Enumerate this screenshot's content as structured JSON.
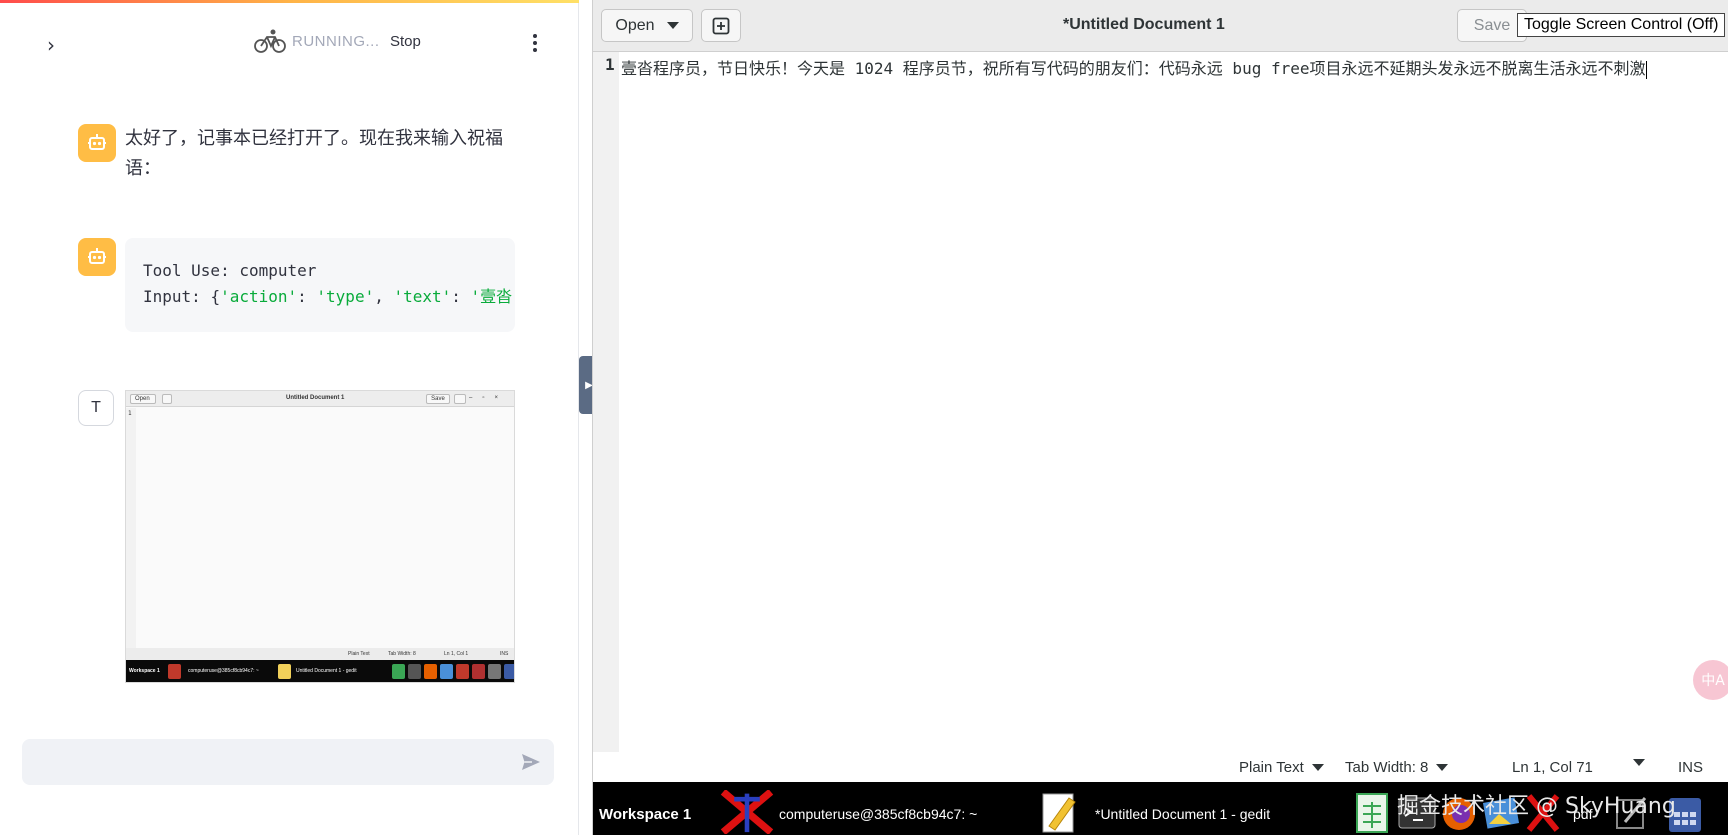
{
  "chat": {
    "status_label": "RUNNING...",
    "stop_label": "Stop",
    "assistant_message": "太好了，记事本已经打开了。现在我来输入祝福语：",
    "tool_line1_key": "Tool Use:",
    "tool_line1_val": "computer",
    "tool_line2_key": "Input:",
    "tool_line2_action_key": "'action'",
    "tool_line2_action_val": "'type'",
    "tool_line2_text_key": "'text'",
    "tool_line2_text_val": "'壹沓",
    "user_avatar_letter": "T",
    "thumbnail": {
      "open": "Open",
      "title": "Untitled Document 1",
      "save": "Save",
      "line_no": "1",
      "status_plain": "Plain Text",
      "status_tab": "Tab Width: 8",
      "status_pos": "Ln 1, Col 1",
      "status_ins": "INS",
      "dock_ws": "Workspace 1",
      "dock_term": "computeruse@385cf8cb94c7: ~",
      "dock_gedit": "Untitled Document 1 - gedit"
    }
  },
  "gedit": {
    "open_label": "Open",
    "title": "*Untitled Document 1",
    "save_label": "Save",
    "toggle_label": "Toggle Screen Control (Off)",
    "line_number": "1",
    "line_text": "壹沓程序员，节日快乐！今天是 1024 程序员节，祝所有写代码的朋友们：代码永远 bug free项目永远不延期头发永远不脱离生活永远不刺激",
    "status": {
      "language": "Plain Text",
      "tab_width": "Tab Width: 8",
      "position": "Ln 1, Col 71",
      "mode": "INS"
    }
  },
  "dock": {
    "workspace": "Workspace 1",
    "terminal_title": "computeruse@385cf8cb94c7: ~",
    "gedit_title": "*Untitled Document 1 - gedit",
    "pdf_label": "pdf"
  },
  "watermark": "掘金技术社区 @ SkyHuang",
  "ime_label": "中A",
  "colors": {
    "bot_avatar": "#ffbd45",
    "code_string": "#09ab3b",
    "collapse_handle": "#5b6b84",
    "dock_bg": "#000000"
  },
  "icons": {
    "collapse": "chevron-right-icon",
    "running": "bicycle-icon",
    "menu": "kebab-menu-icon",
    "bot": "robot-icon",
    "send": "send-icon",
    "new_tab": "new-document-icon"
  }
}
